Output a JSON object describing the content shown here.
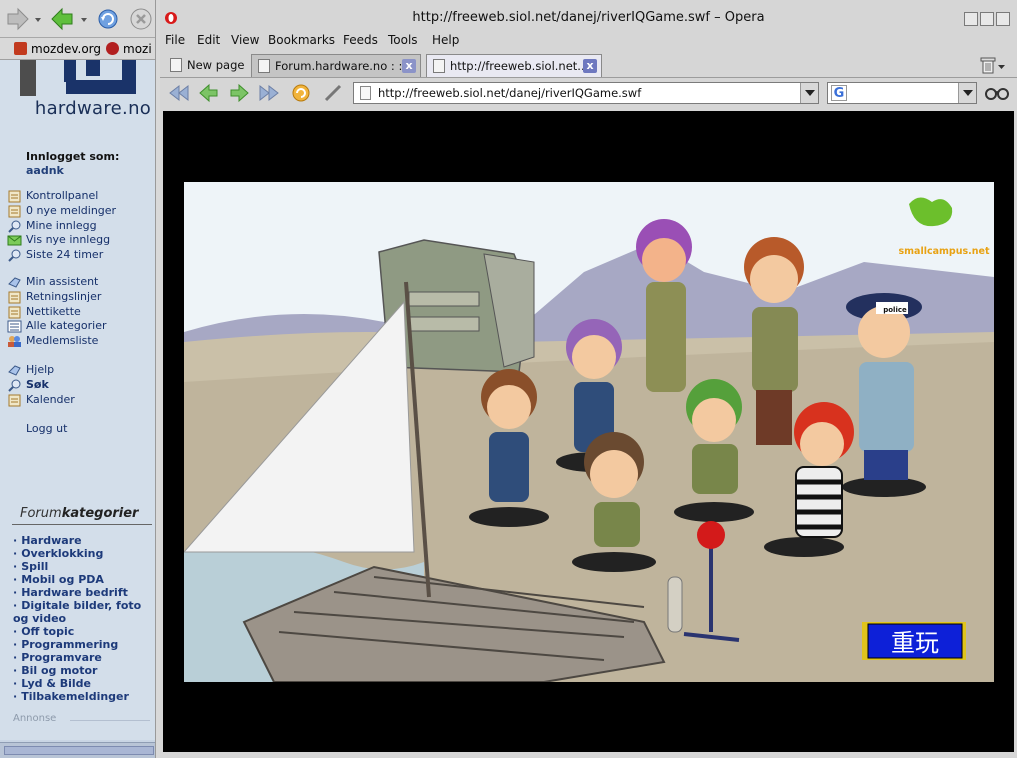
{
  "browser": {
    "window_title": "http://freeweb.siol.net/danej/riverIQGame.swf – Opera",
    "menu": [
      "File",
      "Edit",
      "View",
      "Bookmarks",
      "Feeds",
      "Tools",
      "Help"
    ],
    "tabs": [
      {
        "label": "New page",
        "active": false
      },
      {
        "label": "Forum.hardware.no : : ...",
        "active": false
      },
      {
        "label": "http://freeweb.siol.net...",
        "active": true
      }
    ],
    "address": "http://freeweb.siol.net/danej/riverIQGame.swf",
    "search_engine_icon": "G",
    "colors": {
      "tab_close": "#8b93c8",
      "tab_active": "#e9e9f2",
      "chrome": "#d6d6d6"
    }
  },
  "left_browser": {
    "bookmarks": [
      {
        "label": "mozdev.org",
        "favicon_color": "#c23a1e"
      },
      {
        "label": "mozi",
        "favicon_color": "#b21f1f"
      }
    ]
  },
  "sidebar": {
    "logo_text": "hardware.no",
    "logged_in_label": "Innlogget som:",
    "username": "aadnk",
    "group1": [
      {
        "label": "Kontrollpanel",
        "icon": "document-icon"
      },
      {
        "label": "0 nye meldinger",
        "icon": "document-icon"
      },
      {
        "label": "Mine innlegg",
        "icon": "magnifier-icon"
      },
      {
        "label": "Vis nye innlegg",
        "icon": "envelope-icon"
      },
      {
        "label": "Siste 24 timer",
        "icon": "magnifier-icon"
      }
    ],
    "group2": [
      {
        "label": "Min assistent",
        "icon": "hand-icon"
      },
      {
        "label": "Retningslinjer",
        "icon": "document-icon"
      },
      {
        "label": "Nettikette",
        "icon": "document-icon"
      },
      {
        "label": "Alle kategorier",
        "icon": "list-icon"
      },
      {
        "label": "Medlemsliste",
        "icon": "members-icon"
      }
    ],
    "group3": [
      {
        "label": "Hjelp",
        "icon": "hand-icon",
        "bold": false
      },
      {
        "label": "Søk",
        "icon": "magnifier-icon",
        "bold": true
      },
      {
        "label": "Kalender",
        "icon": "document-icon",
        "bold": false
      }
    ],
    "logout": "Logg ut",
    "forum_categories_title_a": "Forum",
    "forum_categories_title_b": "kategorier",
    "categories": [
      "Hardware",
      "Overklokking",
      "Spill",
      "Mobil og PDA",
      "Hardware bedrift",
      "Digitale bilder, foto og video",
      "Off topic",
      "Programmering",
      "Programvare",
      "Bil og motor",
      "Lyd & Bilde",
      "Tilbakemeldinger"
    ],
    "annonse": "Annonse"
  },
  "game": {
    "brand": "smallcampus.net",
    "police_label": "police",
    "restart_button": "重玩"
  }
}
